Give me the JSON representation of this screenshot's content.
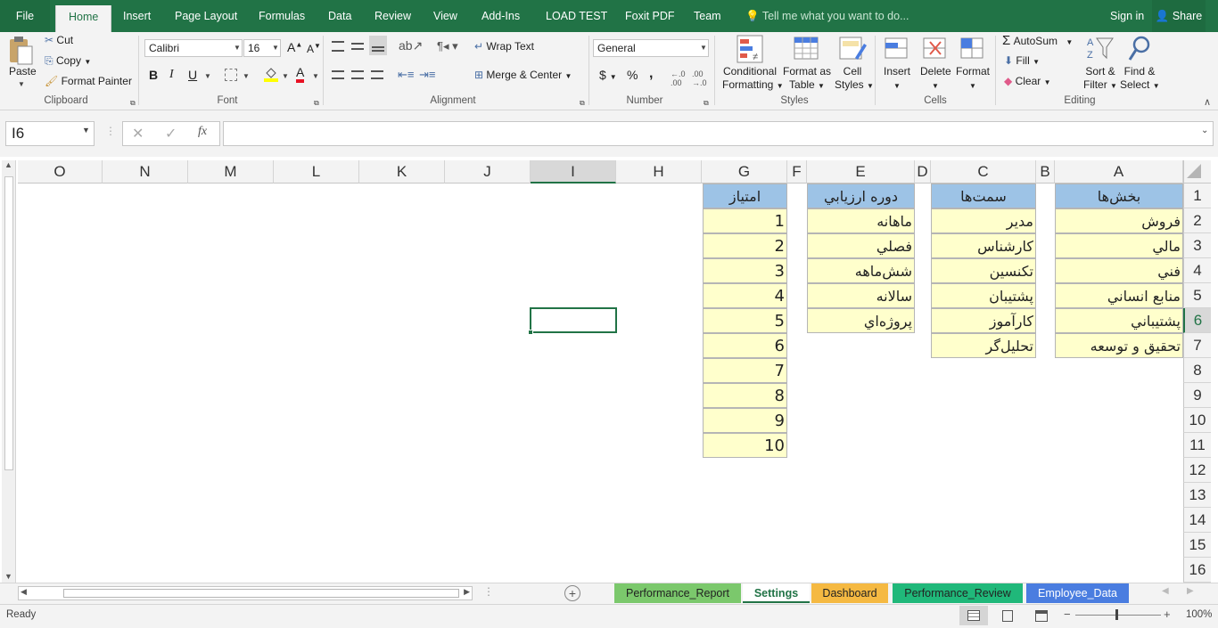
{
  "ribbon_tabs": [
    "File",
    "Home",
    "Insert",
    "Page Layout",
    "Formulas",
    "Data",
    "Review",
    "View",
    "Add-Ins",
    "LOAD TEST",
    "Foxit PDF",
    "Team"
  ],
  "tell_me": "Tell me what you want to do...",
  "sign_in": "Sign in",
  "share": "Share",
  "clipboard": {
    "paste": "Paste",
    "cut": "Cut",
    "copy": "Copy",
    "format_painter": "Format Painter",
    "group": "Clipboard"
  },
  "font": {
    "name": "Calibri",
    "size": "16",
    "bold": "B",
    "italic": "I",
    "underline": "U",
    "grow": "A",
    "shrink": "A",
    "color_a": "A",
    "group": "Font"
  },
  "alignment": {
    "wrap": "Wrap Text",
    "merge": "Merge & Center",
    "group": "Alignment"
  },
  "number": {
    "format": "General",
    "currency": "$",
    "percent": "%",
    "comma": ",",
    "group": "Number"
  },
  "styles": {
    "conditional": "Conditional",
    "conditional2": "Formatting",
    "format_table": "Format as",
    "format_table2": "Table",
    "cell_styles": "Cell",
    "cell_styles2": "Styles",
    "group": "Styles"
  },
  "cells": {
    "insert": "Insert",
    "delete": "Delete",
    "format": "Format",
    "group": "Cells"
  },
  "editing": {
    "autosum": "AutoSum",
    "fill": "Fill",
    "clear": "Clear",
    "sort": "Sort &",
    "sort2": "Filter",
    "find": "Find &",
    "find2": "Select",
    "group": "Editing"
  },
  "formula_bar": {
    "name_box": "I6",
    "fx": "fx",
    "value": ""
  },
  "columns": [
    "O",
    "N",
    "M",
    "L",
    "K",
    "J",
    "I",
    "H",
    "G",
    "F",
    "E",
    "D",
    "C",
    "B",
    "A"
  ],
  "rows": [
    "1",
    "2",
    "3",
    "4",
    "5",
    "6",
    "7",
    "8",
    "9",
    "10",
    "11",
    "12",
    "13",
    "14",
    "15",
    "16"
  ],
  "table_a": {
    "header": "بخش‌ها",
    "values": [
      "فروش",
      "مالي",
      "فني",
      "منابع انساني",
      "پشتيباني",
      "تحقيق و توسعه"
    ]
  },
  "table_c": {
    "header": "سمت‌ها",
    "values": [
      "مدير",
      "كارشناس",
      "تكنسين",
      "پشتيبان",
      "كارآموز",
      "تحليل‌گر"
    ]
  },
  "table_e": {
    "header": "دوره ارزيابي",
    "values": [
      "ماهانه",
      "فصلي",
      "شش‌ماهه",
      "سالانه",
      "پروژه‌اي"
    ]
  },
  "table_g": {
    "header": "امتياز",
    "values": [
      "1",
      "2",
      "3",
      "4",
      "5",
      "6",
      "7",
      "8",
      "9",
      "10"
    ]
  },
  "sheets": [
    {
      "name": "Performance_Report",
      "color": "#7bc86c"
    },
    {
      "name": "Settings",
      "color": "#ffffff",
      "active": true
    },
    {
      "name": "Dashboard",
      "color": "#f5b942"
    },
    {
      "name": "Performance_Review",
      "color": "#20b87a"
    },
    {
      "name": "Employee_Data",
      "color": "#4a7de0"
    }
  ],
  "status": {
    "ready": "Ready",
    "zoom": "100%"
  }
}
